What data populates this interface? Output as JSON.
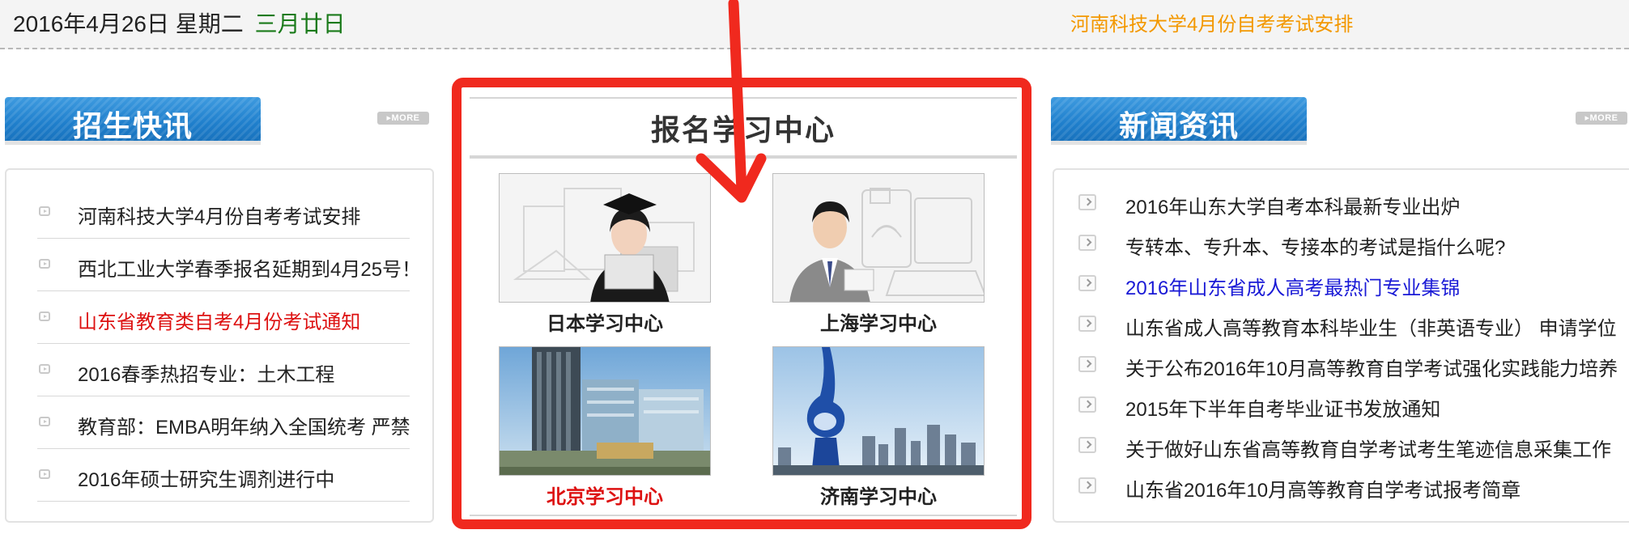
{
  "topbar": {
    "date": "2016年4月26日 星期二",
    "lunar": "三月廿日",
    "notice": "河南科技大学4月份自考考试安排"
  },
  "left": {
    "title": "招生快讯",
    "more": "MORE",
    "items": [
      {
        "text": "河南科技大学4月份自考考试安排",
        "highlight": false
      },
      {
        "text": "西北工业大学春季报名延期到4月25号！",
        "highlight": false
      },
      {
        "text": "山东省教育类自考4月份考试通知",
        "highlight": true,
        "color": "#dd1111"
      },
      {
        "text": "2016春季热招专业：土木工程",
        "highlight": false
      },
      {
        "text": "教育部：EMBA明年纳入全国统考 严禁",
        "highlight": false
      },
      {
        "text": "2016年硕士研究生调剂进行中",
        "highlight": false
      }
    ]
  },
  "center": {
    "title": "报名学习中心",
    "tiles": [
      {
        "caption": "日本学习中心",
        "image": "graduate-woman-photo",
        "highlight": false
      },
      {
        "caption": "上海学习中心",
        "image": "businessman-photo",
        "highlight": false
      },
      {
        "caption": "北京学习中心",
        "image": "beijing-building-photo",
        "highlight": true,
        "color": "#dd1111"
      },
      {
        "caption": "济南学习中心",
        "image": "jinan-monument-photo",
        "highlight": false
      }
    ]
  },
  "right": {
    "title": "新闻资讯",
    "more": "MORE",
    "items": [
      {
        "text": "2016年山东大学自考本科最新专业出炉",
        "highlight": false
      },
      {
        "text": "专转本、专升本、专接本的考试是指什么呢?",
        "highlight": false
      },
      {
        "text": "2016年山东省成人高考最热门专业集锦",
        "highlight": true,
        "color": "#1a1ad6"
      },
      {
        "text": "山东省成人高等教育本科毕业生（非英语专业） 申请学位",
        "highlight": false
      },
      {
        "text": "关于公布2016年10月高等教育自学考试强化实践能力培养",
        "highlight": false
      },
      {
        "text": "2015年下半年自考毕业证书发放通知",
        "highlight": false
      },
      {
        "text": "关于做好山东省高等教育自学考试考生笔迹信息采集工作",
        "highlight": false
      },
      {
        "text": "山东省2016年10月高等教育自学考试报考简章",
        "highlight": false
      }
    ]
  },
  "annotation": {
    "type": "red-arrow",
    "color": "#f0291e"
  },
  "colors": {
    "accent_blue": "#1f7fcc",
    "highlight_red": "#dd1111",
    "notice_orange": "#f39800",
    "lunar_green": "#1a7a1a",
    "link_blue": "#1a1ad6"
  }
}
